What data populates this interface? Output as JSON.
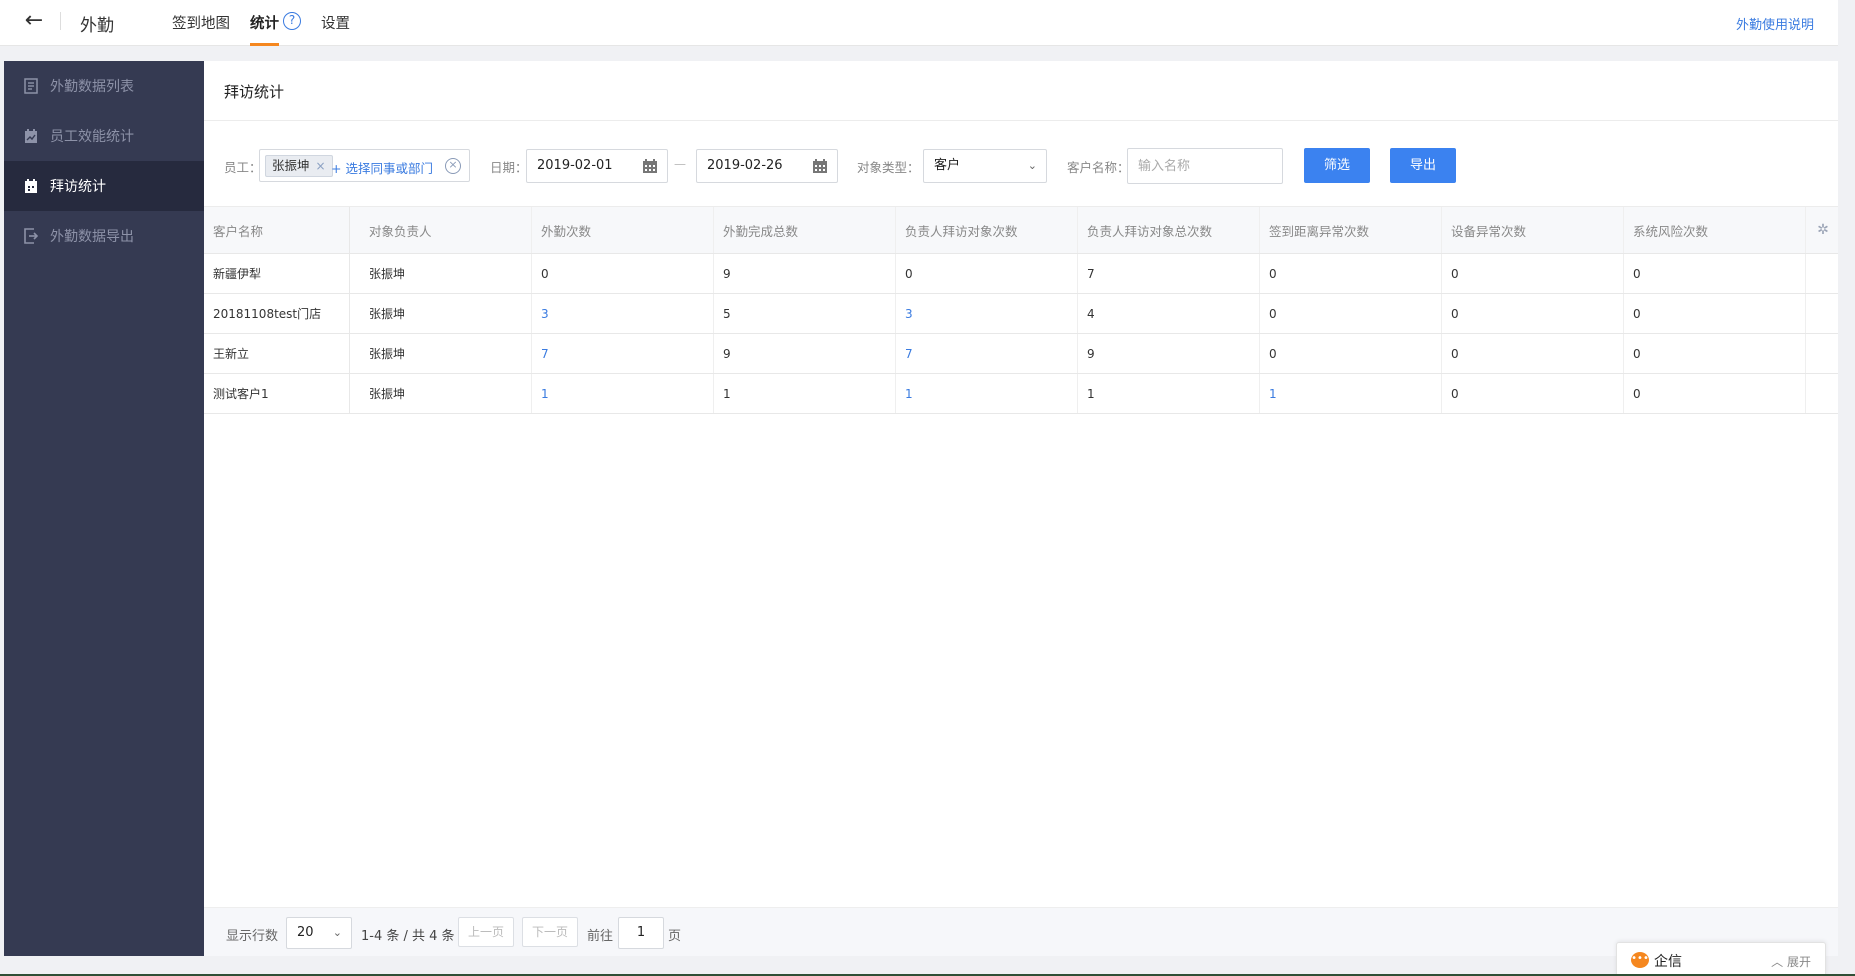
{
  "topbar": {
    "back_icon": "arrow-left-icon",
    "app_title": "外勤",
    "tabs": [
      {
        "label": "签到地图",
        "active": false
      },
      {
        "label": "统计",
        "active": true
      },
      {
        "label": "设置",
        "active": false
      }
    ],
    "help_glyph": "?",
    "help_link": "外勤使用说明"
  },
  "sidebar": {
    "items": [
      {
        "label": "外勤数据列表",
        "icon": "list-doc-icon",
        "active": false
      },
      {
        "label": "员工效能统计",
        "icon": "calendar-chart-icon",
        "active": false
      },
      {
        "label": "拜访统计",
        "icon": "calendar-icon",
        "active": true
      },
      {
        "label": "外勤数据导出",
        "icon": "export-icon",
        "active": false
      }
    ]
  },
  "main": {
    "title": "拜访统计",
    "filters": {
      "employee_label": "员工：",
      "employee_tag": "张振坤",
      "tag_remove": "×",
      "employee_add": "+ 选择同事或部门",
      "clear_glyph": "×",
      "date_label": "日期：",
      "date_start": "2019-02-01",
      "date_sep": "—",
      "date_end": "2019-02-26",
      "type_label": "对象类型：",
      "type_value": "客户",
      "name_label": "客户名称：",
      "name_placeholder": "输入名称",
      "filter_button": "筛选",
      "export_button": "导出"
    },
    "table": {
      "columns": [
        "客户名称",
        "对象负责人",
        "外勤次数",
        "外勤完成总数",
        "负责人拜访对象次数",
        "负责人拜访对象总次数",
        "签到距离异常次数",
        "设备异常次数",
        "系统风险次数"
      ],
      "settings_icon": "gear-icon",
      "rows": [
        {
          "name": "新疆伊犁",
          "owner": "张振坤",
          "visits": "0",
          "completed": "9",
          "owner_visits": "0",
          "owner_total": "7",
          "distance_abn": "0",
          "device_abn": "0",
          "risk": "0"
        },
        {
          "name": "20181108test门店",
          "owner": "张振坤",
          "visits": "3",
          "completed": "5",
          "owner_visits": "3",
          "owner_total": "4",
          "distance_abn": "0",
          "device_abn": "0",
          "risk": "0"
        },
        {
          "name": "王新立",
          "owner": "张振坤",
          "visits": "7",
          "completed": "9",
          "owner_visits": "7",
          "owner_total": "9",
          "distance_abn": "0",
          "device_abn": "0",
          "risk": "0"
        },
        {
          "name": "测试客户1",
          "owner": "张振坤",
          "visits": "1",
          "completed": "1",
          "owner_visits": "1",
          "owner_total": "1",
          "distance_abn": "1",
          "device_abn": "0",
          "risk": "0"
        }
      ],
      "link_color": "#3a7be0"
    },
    "pagination": {
      "rows_label": "显示行数",
      "rows_value": "20",
      "range_text": "1-4 条 / 共 4 条",
      "prev": "上一页",
      "next": "下一页",
      "goto_label": "前往",
      "page_value": "1",
      "page_unit": "页"
    }
  },
  "chat": {
    "label": "企信",
    "expand": "展开",
    "icon": "chat-bubble-icon"
  },
  "colors": {
    "accent": "#3b82f0",
    "sidebar_bg": "#353a52",
    "sidebar_active": "#262a3e",
    "tab_underline": "#f5871f"
  }
}
